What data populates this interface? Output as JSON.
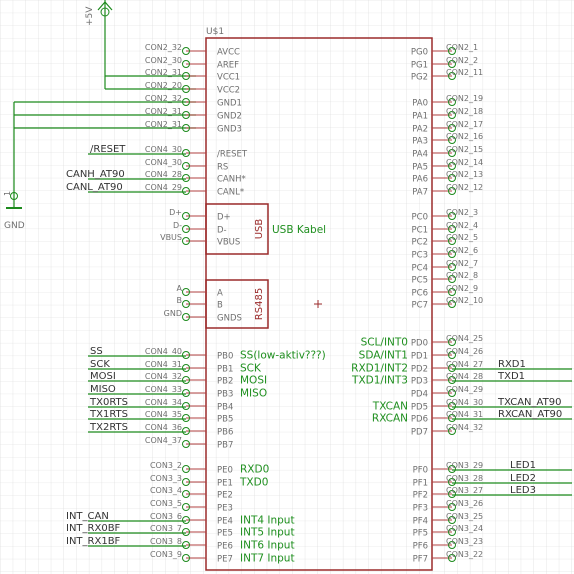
{
  "chip": {
    "name": "U$1",
    "left_pins": [
      {
        "con": "CON2_32",
        "pin": "AVCC"
      },
      {
        "con": "CON2_30",
        "pin": "AREF"
      },
      {
        "con": "CON2_31",
        "pin": "VCC1"
      },
      {
        "con": "CON2_20",
        "pin": "VCC2"
      },
      {
        "con": "CON2_32",
        "pin": "GND1"
      },
      {
        "con": "CON2_31",
        "pin": "GND2"
      },
      {
        "con": "CON2_31",
        "pin": "GND3"
      },
      {
        "con": "CON4_30",
        "pin": "/RESET",
        "net": "/RESET"
      },
      {
        "con": "CON4_30",
        "pin": "RS"
      },
      {
        "con": "CON4_28",
        "pin": "CANH*",
        "net": "CANH_AT90"
      },
      {
        "con": "CON4_29",
        "pin": "CANL*",
        "net": "CANL_AT90"
      },
      {
        "con": "D+",
        "pin": "D+"
      },
      {
        "con": "D-",
        "pin": "D-"
      },
      {
        "con": "VBUS",
        "pin": "VBUS"
      },
      {
        "con": "A",
        "pin": "A"
      },
      {
        "con": "B",
        "pin": "B"
      },
      {
        "con": "GND",
        "pin": "GNDS"
      },
      {
        "con": "CON4_40",
        "pin": "PB0",
        "net": "SS",
        "func": "SS(low-aktiv???)"
      },
      {
        "con": "CON4_31",
        "pin": "PB1",
        "net": "SCK",
        "func": "SCK"
      },
      {
        "con": "CON4_32",
        "pin": "PB2",
        "net": "MOSI",
        "func": "MOSI"
      },
      {
        "con": "CON4_33",
        "pin": "PB3",
        "net": "MISO",
        "func": "MISO"
      },
      {
        "con": "CON4_34",
        "pin": "PB4",
        "net": "TX0RTS"
      },
      {
        "con": "CON4_35",
        "pin": "PB5",
        "net": "TX1RTS"
      },
      {
        "con": "CON4_36",
        "pin": "PB6",
        "net": "TX2RTS"
      },
      {
        "con": "CON4_37",
        "pin": "PB7"
      },
      {
        "con": "CON3_2",
        "pin": "PE0",
        "func": "RXD0"
      },
      {
        "con": "CON3_3",
        "pin": "PE1",
        "func": "TXD0"
      },
      {
        "con": "CON3_4",
        "pin": "PE2"
      },
      {
        "con": "CON3_5",
        "pin": "PE3"
      },
      {
        "con": "CON3_6",
        "pin": "PE4",
        "net": "INT_CAN",
        "func": "INT4 Input"
      },
      {
        "con": "CON3_7",
        "pin": "PE5",
        "net": "INT_RX0BF",
        "func": "INT5 Input"
      },
      {
        "con": "CON3_8",
        "pin": "PE6",
        "net": "INT_RX1BF",
        "func": "INT6 Input"
      },
      {
        "con": "CON3_9",
        "pin": "PE7",
        "func": "INT7 Input"
      }
    ],
    "right_pins": [
      {
        "pin": "PG0",
        "con": "CON2_1"
      },
      {
        "pin": "PG1",
        "con": "CON2_2"
      },
      {
        "pin": "PG2",
        "con": "CON2_11"
      },
      {
        "pin": "PA0",
        "con": "CON2_19"
      },
      {
        "pin": "PA1",
        "con": "CON2_18"
      },
      {
        "pin": "PA2",
        "con": "CON2_17"
      },
      {
        "pin": "PA3",
        "con": "CON2_16"
      },
      {
        "pin": "PA4",
        "con": "CON2_15"
      },
      {
        "pin": "PA5",
        "con": "CON2_14"
      },
      {
        "pin": "PA6",
        "con": "CON2_13"
      },
      {
        "pin": "PA7",
        "con": "CON2_12"
      },
      {
        "pin": "PC0",
        "con": "CON2_3"
      },
      {
        "pin": "PC1",
        "con": "CON2_4"
      },
      {
        "pin": "PC2",
        "con": "CON2_5"
      },
      {
        "pin": "PC3",
        "con": "CON2_6"
      },
      {
        "pin": "PC4",
        "con": "CON2_7"
      },
      {
        "pin": "PC5",
        "con": "CON2_8"
      },
      {
        "pin": "PC6",
        "con": "CON2_9"
      },
      {
        "pin": "PC7",
        "con": "CON2_10"
      },
      {
        "pin": "PD0",
        "con": "CON4_25",
        "func": "SCL/INT0"
      },
      {
        "pin": "PD1",
        "con": "CON4_26",
        "func": "SDA/INT1"
      },
      {
        "pin": "PD2",
        "con": "CON4_27",
        "func": "RXD1/INT2",
        "net": "RXD1"
      },
      {
        "pin": "PD3",
        "con": "CON4_28",
        "func": "TXD1/INT3",
        "net": "TXD1"
      },
      {
        "pin": "PD4",
        "con": "CON4_29"
      },
      {
        "pin": "PD5",
        "con": "CON4_30",
        "func": "TXCAN",
        "net": "TXCAN_AT90"
      },
      {
        "pin": "PD6",
        "con": "CON4_31",
        "func": "RXCAN",
        "net": "RXCAN_AT90"
      },
      {
        "pin": "PD7",
        "con": "CON4_32"
      },
      {
        "pin": "PF0",
        "con": "CON3_29",
        "net": "LED1"
      },
      {
        "pin": "PF1",
        "con": "CON3_28",
        "net": "LED2"
      },
      {
        "pin": "PF2",
        "con": "CON3_27",
        "net": "LED3"
      },
      {
        "pin": "PF3",
        "con": "CON3_26"
      },
      {
        "pin": "PF4",
        "con": "CON3_25"
      },
      {
        "pin": "PF5",
        "con": "CON3_24"
      },
      {
        "pin": "PF6",
        "con": "CON3_23"
      },
      {
        "pin": "PF7",
        "con": "CON3_22"
      }
    ]
  },
  "usb_box_label": "USB",
  "usb_kabel_label": "USB Kabel",
  "rs485_label": "RS485",
  "supply_label": "+5V",
  "gnd_label": "GND",
  "gnd_pin_label": "1",
  "colors": {
    "net": "#1c8a1c",
    "body": "#9b2b2b",
    "grid": "#d7d7d7",
    "text": "#6f6f6f"
  }
}
